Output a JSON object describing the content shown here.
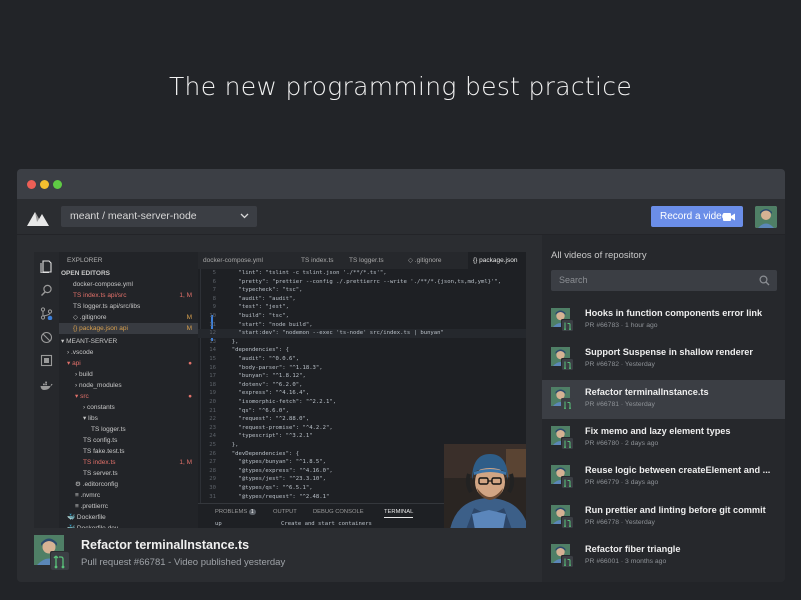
{
  "headline": "The new programming best practice",
  "app": {
    "repo": "meant / meant-server-node",
    "record_label": "Record a video"
  },
  "editor": {
    "explorer_label": "EXPLORER",
    "open_editors_label": "OPEN EDITORS",
    "project_label": "MEANT-SERVER",
    "explorer_lines": [
      {
        "text": "docker-compose.yml",
        "indent": 14,
        "color": "#c8c8c8",
        "mark": ""
      },
      {
        "text": "TS index.ts  api/src",
        "indent": 14,
        "color": "#e2716a",
        "mark": "1, M"
      },
      {
        "text": "TS logger.ts  api/src/libs",
        "indent": 14,
        "color": "#c8c8c8",
        "mark": ""
      },
      {
        "text": "◇ .gitignore",
        "indent": 14,
        "color": "#c8c8c8",
        "mark": "M"
      },
      {
        "text": "{} package.json  api",
        "indent": 14,
        "color": "#d8a04e",
        "mark": "M",
        "selected": true
      },
      {
        "text": "▾ MEANT-SERVER",
        "indent": 2,
        "color": "#c8c8c8",
        "mark": ""
      },
      {
        "text": "› .vscode",
        "indent": 8,
        "color": "#c8c8c8",
        "mark": ""
      },
      {
        "text": "▾ api",
        "indent": 8,
        "color": "#e2716a",
        "mark": "●"
      },
      {
        "text": "› build",
        "indent": 16,
        "color": "#c8c8c8",
        "mark": ""
      },
      {
        "text": "› node_modules",
        "indent": 16,
        "color": "#c8c8c8",
        "mark": ""
      },
      {
        "text": "▾ src",
        "indent": 16,
        "color": "#e2716a",
        "mark": "●"
      },
      {
        "text": "› constants",
        "indent": 24,
        "color": "#c8c8c8",
        "mark": ""
      },
      {
        "text": "▾ libs",
        "indent": 24,
        "color": "#c8c8c8",
        "mark": ""
      },
      {
        "text": "TS logger.ts",
        "indent": 32,
        "color": "#c8c8c8",
        "mark": ""
      },
      {
        "text": "TS config.ts",
        "indent": 24,
        "color": "#c8c8c8",
        "mark": ""
      },
      {
        "text": "TS fake.test.ts",
        "indent": 24,
        "color": "#c8c8c8",
        "mark": ""
      },
      {
        "text": "TS index.ts",
        "indent": 24,
        "color": "#e2716a",
        "mark": "1, M"
      },
      {
        "text": "TS server.ts",
        "indent": 24,
        "color": "#c8c8c8",
        "mark": ""
      },
      {
        "text": "⚙ .editorconfig",
        "indent": 16,
        "color": "#c8c8c8",
        "mark": ""
      },
      {
        "text": "≡ .nvmrc",
        "indent": 16,
        "color": "#c8c8c8",
        "mark": ""
      },
      {
        "text": "≡ .prettierrc",
        "indent": 16,
        "color": "#c8c8c8",
        "mark": ""
      },
      {
        "text": "🐳 Dockerfile",
        "indent": 8,
        "color": "#c8c8c8",
        "mark": ""
      },
      {
        "text": "🐳 Dockerfile.dev",
        "indent": 8,
        "color": "#c8c8c8",
        "mark": ""
      }
    ],
    "tabs": [
      "docker-compose.yml",
      "TS index.ts",
      "TS logger.ts",
      "◇ .gitignore",
      "{} package.json"
    ],
    "code_lines": [
      {
        "n": "5",
        "t": "    \"lint\": \"tslint -c tslint.json './**/*.ts'\","
      },
      {
        "n": "6",
        "t": "    \"pretty\": \"prettier --config ./.prettierrc --write './**/*.{json,ts,md,yml}'\","
      },
      {
        "n": "7",
        "t": "    \"typecheck\": \"tsc\","
      },
      {
        "n": "8",
        "t": "    \"audit\": \"audit\","
      },
      {
        "n": "9",
        "t": "    \"test\": \"jest\","
      },
      {
        "n": "10",
        "t": "    \"build\": \"tsc\","
      },
      {
        "n": "11",
        "t": "    \"start\": \"node build\","
      },
      {
        "n": "12",
        "t": "    \"start:dev\": \"nodemon --exec 'ts-node' src/index.ts | bunyan\"",
        "cur": true
      },
      {
        "n": "13",
        "t": "  },"
      },
      {
        "n": "14",
        "t": "  \"dependencies\": {"
      },
      {
        "n": "15",
        "t": "    \"audit\": \"^0.0.6\","
      },
      {
        "n": "16",
        "t": "    \"body-parser\": \"^1.18.3\","
      },
      {
        "n": "17",
        "t": "    \"bunyan\": \"^1.8.12\","
      },
      {
        "n": "18",
        "t": "    \"dotenv\": \"^6.2.0\","
      },
      {
        "n": "19",
        "t": "    \"express\": \"^4.16.4\","
      },
      {
        "n": "20",
        "t": "    \"isomorphic-fetch\": \"^2.2.1\","
      },
      {
        "n": "21",
        "t": "    \"qs\": \"^6.6.0\","
      },
      {
        "n": "22",
        "t": "    \"request\": \"^2.88.0\","
      },
      {
        "n": "23",
        "t": "    \"request-promise\": \"^4.2.2\","
      },
      {
        "n": "24",
        "t": "    \"typescript\": \"^3.2.1\""
      },
      {
        "n": "25",
        "t": "  },"
      },
      {
        "n": "26",
        "t": "  \"devDependencies\": {"
      },
      {
        "n": "27",
        "t": "    \"@types/bunyan\": \"^1.8.5\","
      },
      {
        "n": "28",
        "t": "    \"@types/express\": \"^4.16.0\","
      },
      {
        "n": "29",
        "t": "    \"@types/jest\": \"^23.3.10\","
      },
      {
        "n": "30",
        "t": "    \"@types/qs\": \"^6.5.1\","
      },
      {
        "n": "31",
        "t": "    \"@types/request\": \"^2.48.1\""
      }
    ],
    "terminal_tabs": {
      "problems": "PROBLEMS",
      "problems_count": "1",
      "output": "OUTPUT",
      "debug": "DEBUG CONSOLE",
      "terminal": "TERMINAL"
    },
    "terminal_left": "up",
    "terminal_text": "Create and start containers"
  },
  "current_video": {
    "title": "Refactor terminalInstance.ts",
    "subtitle": "Pull request #66781 - Video published yesterday"
  },
  "sidebar": {
    "title": "All videos of repository",
    "search_placeholder": "Search",
    "videos": [
      {
        "title": "Hooks in function components error link",
        "meta": "PR #66783 · 1 hour ago"
      },
      {
        "title": "Support Suspense in shallow renderer",
        "meta": "PR #66782 · Yesterday"
      },
      {
        "title": "Refactor terminalInstance.ts",
        "meta": "PR #66781 · Yesterday",
        "active": true
      },
      {
        "title": "Fix memo and lazy element types",
        "meta": "PR #66780 · 2 days ago"
      },
      {
        "title": "Reuse logic between createElement and ...",
        "meta": "PR #66779 · 3 days ago"
      },
      {
        "title": "Run prettier and linting before git commit",
        "meta": "PR #66778 · Yesterday"
      },
      {
        "title": "Refactor fiber triangle",
        "meta": "PR #66001 · 3 months ago"
      }
    ]
  },
  "colors": {
    "accent": "#6b8ee8",
    "background": "#222428",
    "window": "#2b2d31",
    "sidebar": "#26282c"
  }
}
